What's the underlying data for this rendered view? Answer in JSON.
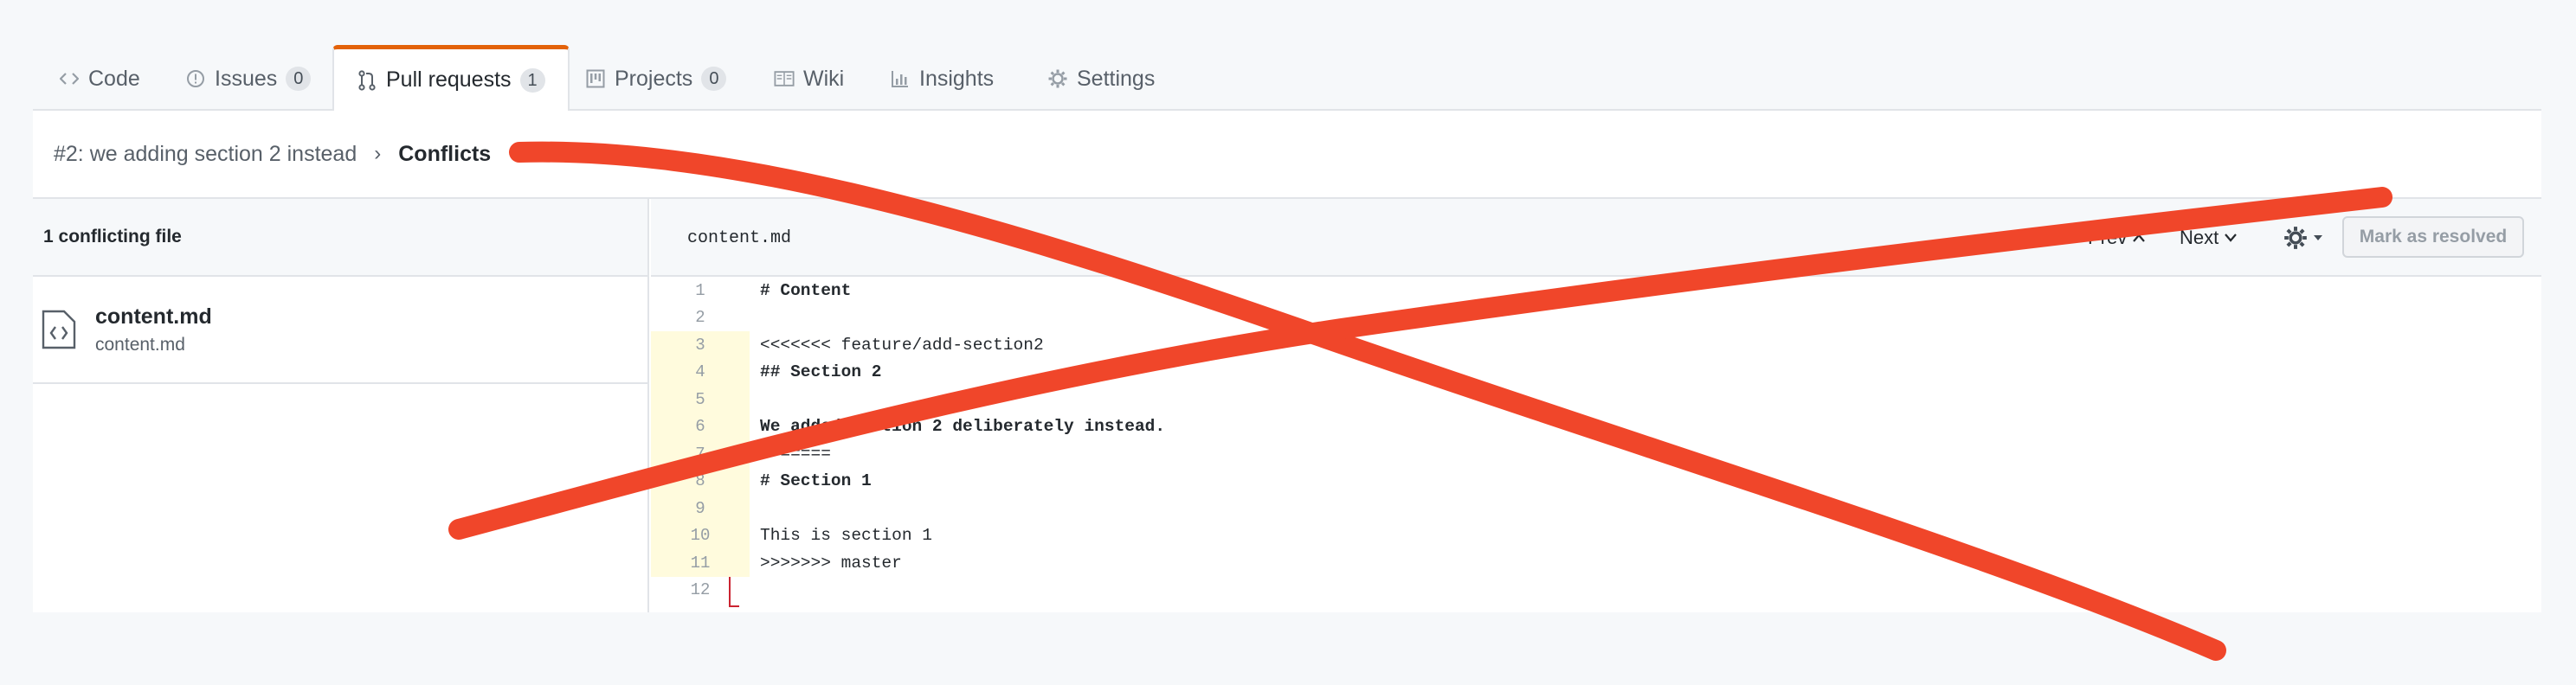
{
  "tabs": [
    {
      "label": "Code",
      "icon": "code-icon"
    },
    {
      "label": "Issues",
      "icon": "issue-icon",
      "count": "0"
    },
    {
      "label": "Pull requests",
      "icon": "pull-request-icon",
      "count": "1",
      "selected": true
    },
    {
      "label": "Projects",
      "icon": "project-icon",
      "count": "0"
    },
    {
      "label": "Wiki",
      "icon": "book-icon"
    },
    {
      "label": "Insights",
      "icon": "graph-icon"
    },
    {
      "label": "Settings",
      "icon": "gear-icon"
    }
  ],
  "breadcrumb": {
    "pr_link": "#2: we adding section 2 instead",
    "separator": "›",
    "current": "Conflicts"
  },
  "sidebar": {
    "header": "1 conflicting file",
    "files": [
      {
        "name": "content.md",
        "path": "content.md",
        "icon": "file-code-icon"
      }
    ]
  },
  "editor": {
    "filename": "content.md",
    "prev_label": "Prev",
    "next_label": "Next",
    "settings_icon": "gear-icon",
    "mark_resolved_label": "Mark as resolved",
    "lines": [
      {
        "n": "1",
        "text": "# Content",
        "bold": true,
        "conflict": false
      },
      {
        "n": "2",
        "text": "",
        "bold": false,
        "conflict": false
      },
      {
        "n": "3",
        "text": "<<<<<<< feature/add-section2",
        "bold": false,
        "conflict": true
      },
      {
        "n": "4",
        "text": "## Section 2",
        "bold": true,
        "conflict": true
      },
      {
        "n": "5",
        "text": "",
        "bold": false,
        "conflict": true
      },
      {
        "n": "6",
        "text": "We added section 2 deliberately instead.",
        "bold": true,
        "conflict": true
      },
      {
        "n": "7",
        "text": "=======",
        "bold": false,
        "conflict": true
      },
      {
        "n": "8",
        "text": "# Section 1",
        "bold": true,
        "conflict": true
      },
      {
        "n": "9",
        "text": "",
        "bold": false,
        "conflict": true
      },
      {
        "n": "10",
        "text": "This is section 1",
        "bold": false,
        "conflict": true
      },
      {
        "n": "11",
        "text": ">>>>>>> master",
        "bold": false,
        "conflict": true
      },
      {
        "n": "12",
        "text": "",
        "bold": false,
        "conflict": false
      }
    ]
  },
  "colors": {
    "accent_tab": "#e36209",
    "conflict_marker": "#cb2431",
    "conflict_gutter": "#fffbdd",
    "strike_overlay": "#f0462a"
  }
}
